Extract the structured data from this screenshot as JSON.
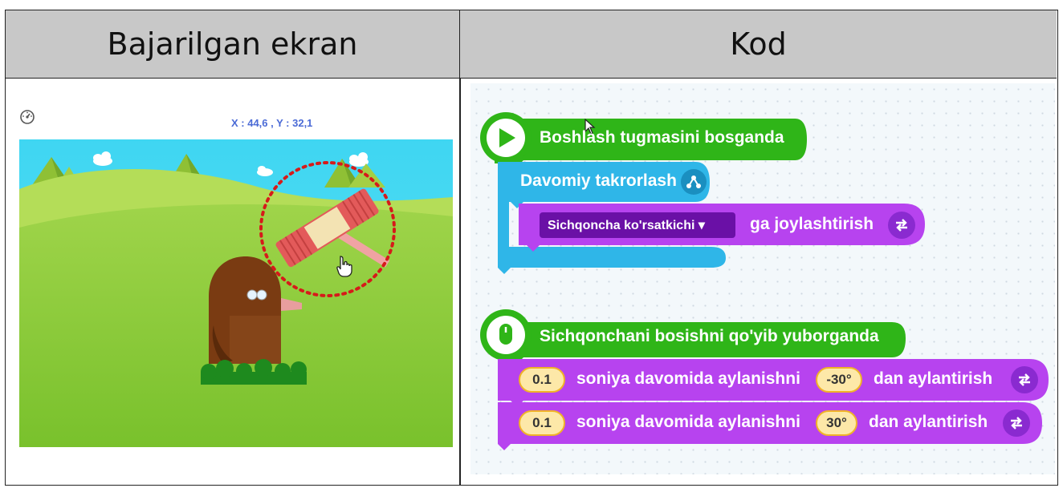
{
  "table": {
    "left_header": "Bajarilgan ekran",
    "right_header": "Kod"
  },
  "game": {
    "coordinates": "X : 44,6 , Y : 32,1",
    "speed_icon": "speedometer-icon"
  },
  "code": {
    "start_block": {
      "label": "Boshlash tugmasini bosganda",
      "color": "#2fb518",
      "icon": "play-icon"
    },
    "repeat_block": {
      "label": "Davomiy takrorlash",
      "color": "#2fb6e8",
      "icon": "loop-icon"
    },
    "move_block": {
      "dropdown": "Sichqoncha ko'rsatkichi ▾",
      "label": "ga joylashtirish",
      "color": "#b743ef",
      "icon": "move-arrows-icon"
    },
    "mouse_block": {
      "label": "Sichqonchani bosishni qo'yib yuborganda",
      "color": "#2fb518",
      "icon": "mouse-icon"
    },
    "rotate_blocks": [
      {
        "seconds": "0.1",
        "text": "soniya davomida aylanishni",
        "angle": "-30°",
        "suffix": "dan aylantirish"
      },
      {
        "seconds": "0.1",
        "text": "soniya davomida aylanishni",
        "angle": "30°",
        "suffix": "dan aylantirish"
      }
    ],
    "rotate_color": "#b743ef"
  }
}
